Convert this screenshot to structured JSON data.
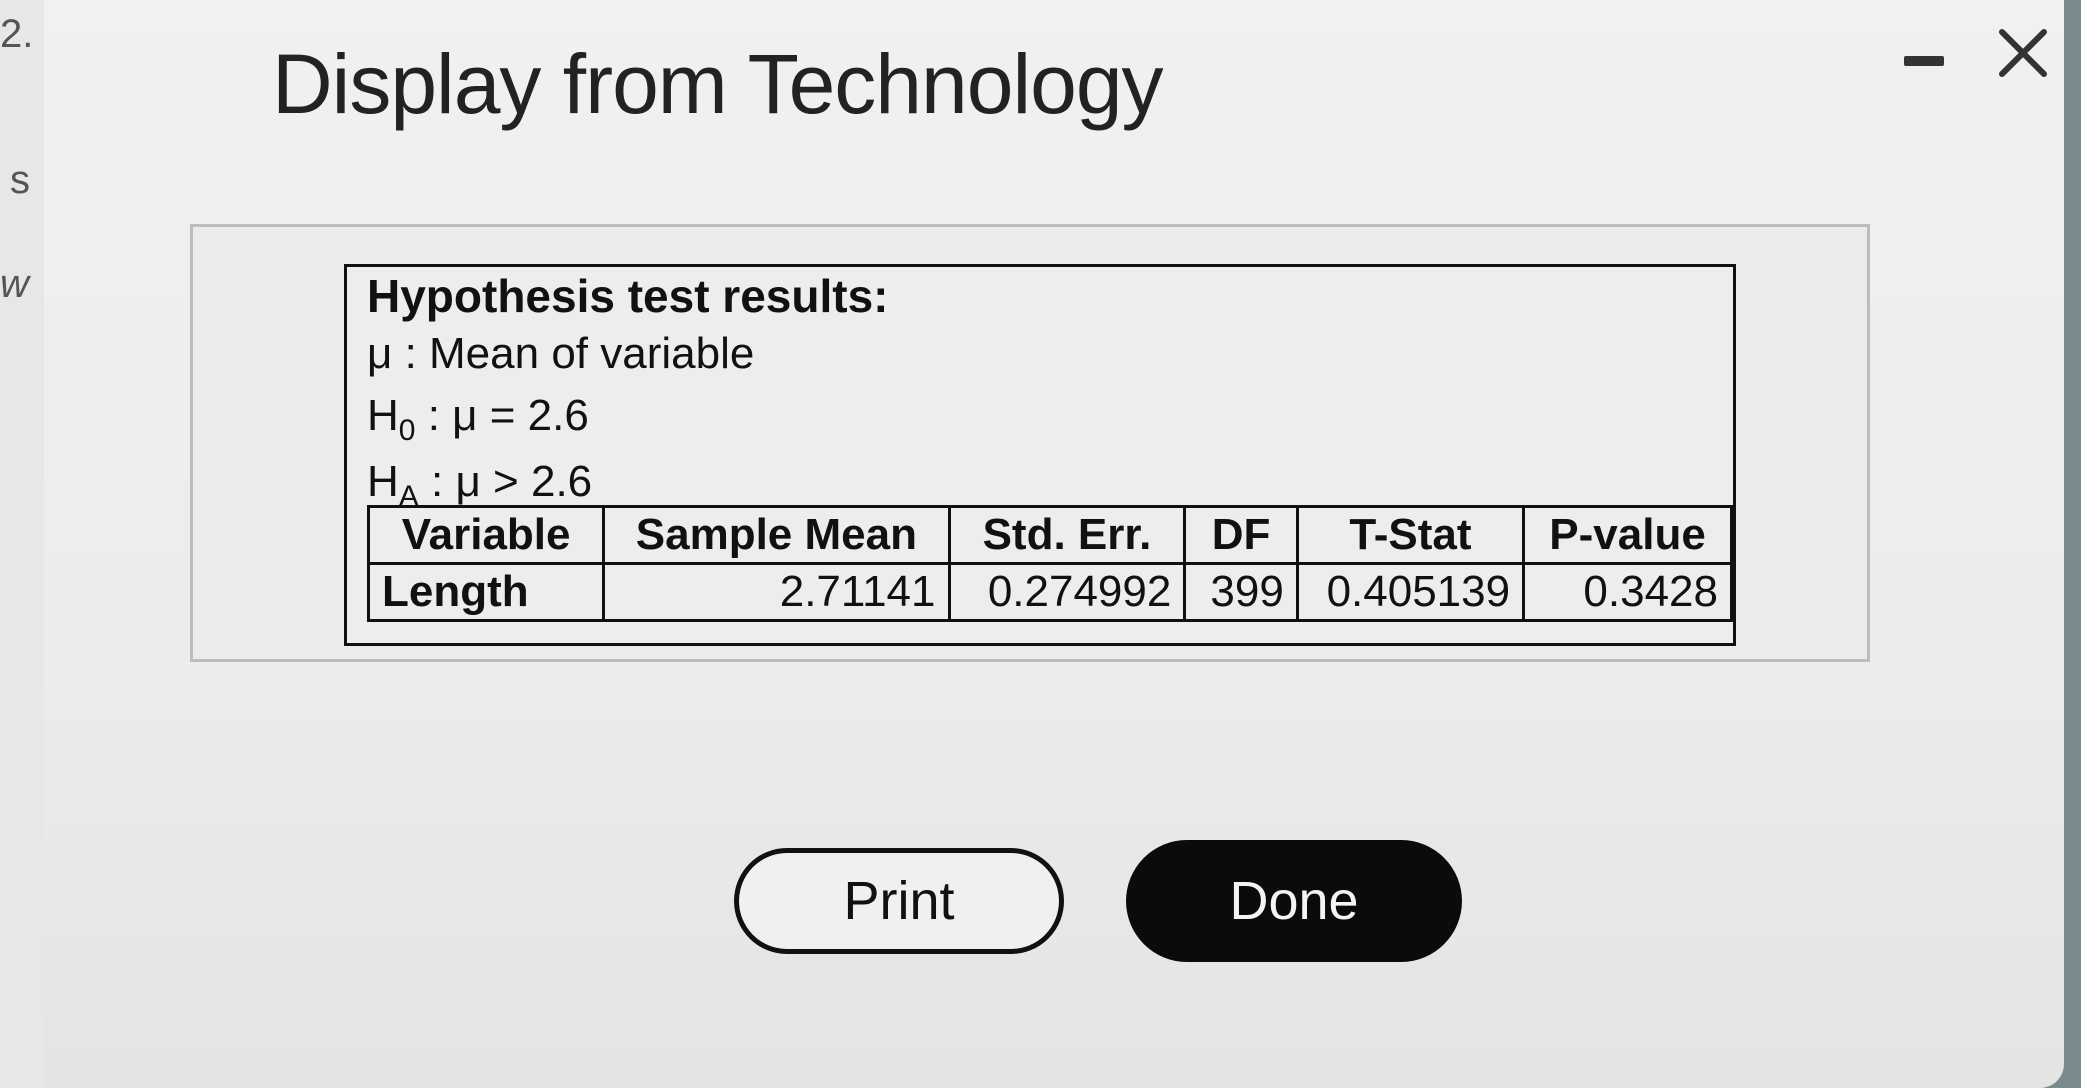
{
  "background": {
    "question_number": "2.",
    "fragment_s": "s",
    "fragment_w": "w"
  },
  "dialog": {
    "title": "Display from Technology",
    "minimize_icon": "minimize-icon",
    "close_icon": "close-icon"
  },
  "results": {
    "heading": "Hypothesis test results:",
    "mu_line": "μ : Mean of variable",
    "h0": {
      "symbol": "H",
      "sub": "0",
      "rest": " : μ = 2.6"
    },
    "ha": {
      "symbol": "H",
      "sub": "A",
      "rest": " : μ > 2.6"
    },
    "table": {
      "headers": [
        "Variable",
        "Sample Mean",
        "Std. Err.",
        "DF",
        "T-Stat",
        "P-value"
      ],
      "rows": [
        [
          "Length",
          "2.71141",
          "0.274992",
          "399",
          "0.405139",
          "0.3428"
        ]
      ]
    }
  },
  "buttons": {
    "print": "Print",
    "done": "Done"
  },
  "colors": {
    "dialog_bg": "#ededec",
    "done_bg": "#0b0b0b",
    "text": "#111111"
  }
}
